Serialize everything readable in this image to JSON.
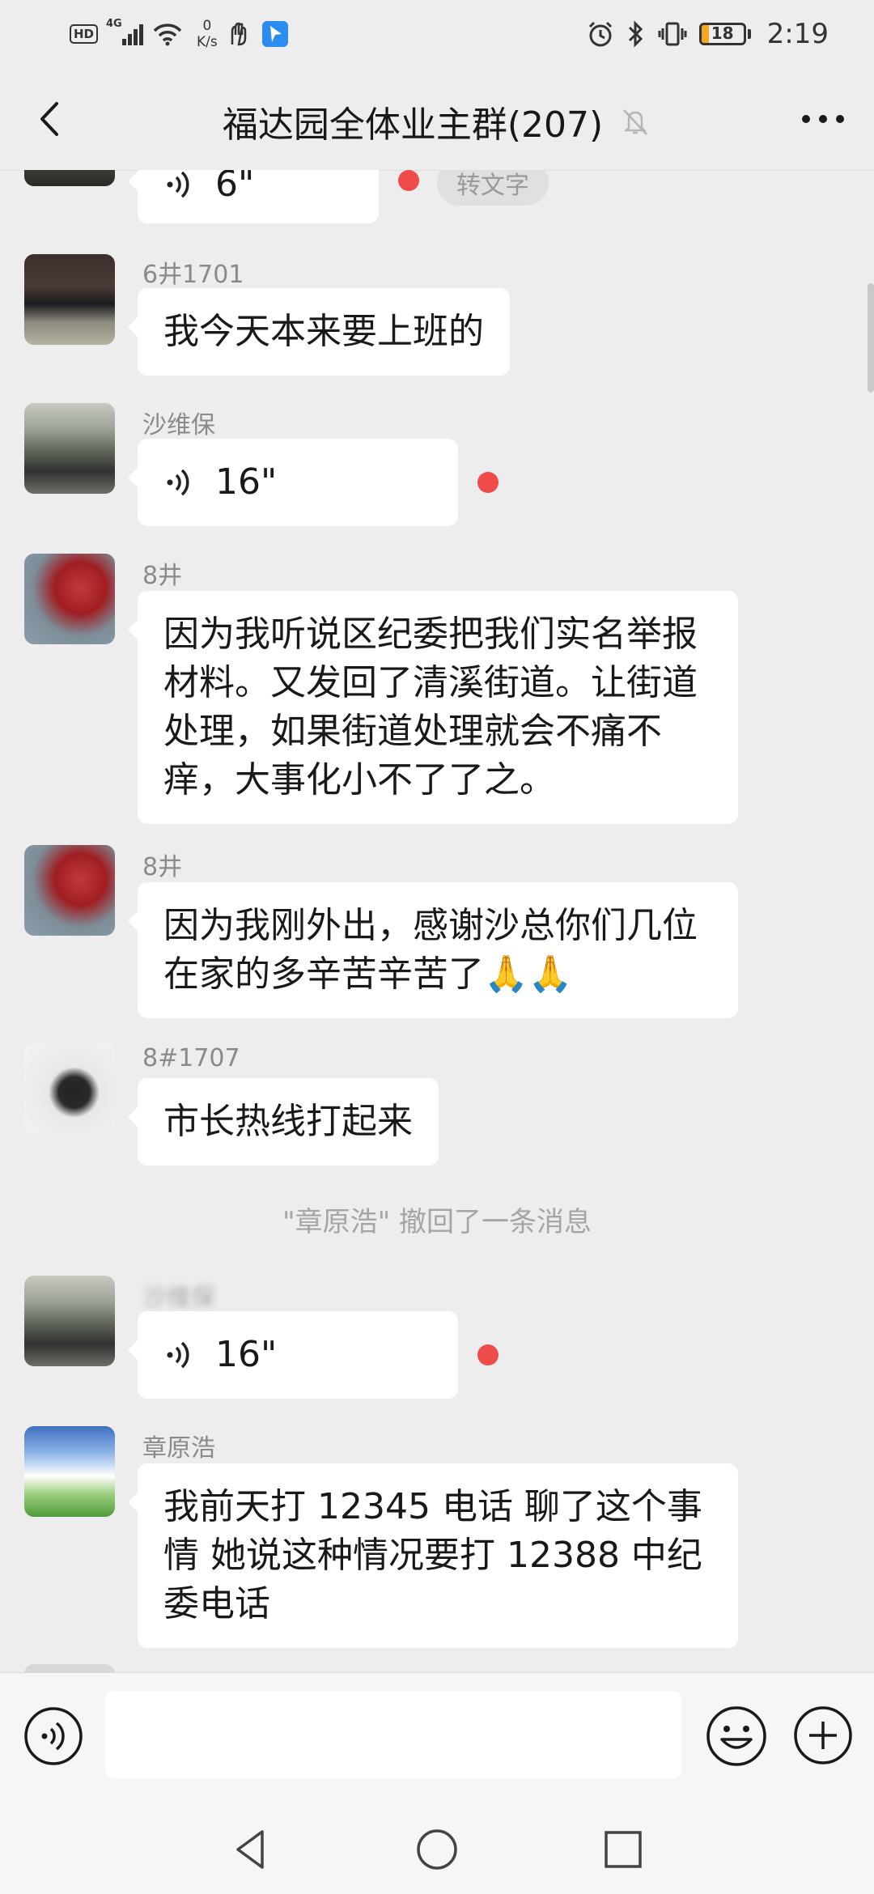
{
  "status_bar": {
    "hd_label": "HD",
    "network_label": "4G",
    "speed_value": "0",
    "speed_unit": "K/s",
    "battery_level": "18",
    "battery_fraction": 0.18,
    "time": "2:19"
  },
  "nav": {
    "title": "福达园全体业主群(207)"
  },
  "messages": {
    "m0": {
      "duration": "6\"",
      "convert_label": "转文字"
    },
    "m1": {
      "sender": "6井1701",
      "text": "我今天本来要上班的"
    },
    "m2": {
      "sender": "沙维保",
      "duration": "16\""
    },
    "m3": {
      "sender": "8井",
      "lines": [
        "因为我听说区纪委把我们实名举报",
        "材料。又发回了清溪街道。让街道",
        "处理，如果街道处理就会不痛不",
        "痒，大事化小不了了之。"
      ]
    },
    "m4": {
      "sender": "8井",
      "lines": [
        "因为我刚外出，感谢沙总你们几位",
        "在家的多辛苦辛苦了"
      ],
      "emoji": "🙏🙏"
    },
    "m5": {
      "sender": "8#1707",
      "text": "市长热线打起来"
    },
    "system": "\"章原浩\" 撤回了一条消息",
    "m6": {
      "sender": "沙维保",
      "duration": "16\""
    },
    "m7": {
      "sender": "章原浩",
      "lines": [
        "我前天打 12345 电话 聊了这个事",
        "情 她说这种情况要打 12388 中纪",
        "委电话"
      ]
    }
  },
  "colors": {
    "background": "#ededed",
    "bubble": "#ffffff",
    "unread_dot": "#f04b4b",
    "battery": "#f5a623"
  },
  "icons": [
    "back-arrow-icon",
    "mute-bell-icon",
    "more-icon",
    "voice-wave-icon",
    "voice-input-icon",
    "emoji-icon",
    "plus-icon",
    "nav-back-icon",
    "nav-home-icon",
    "nav-recents-icon"
  ]
}
